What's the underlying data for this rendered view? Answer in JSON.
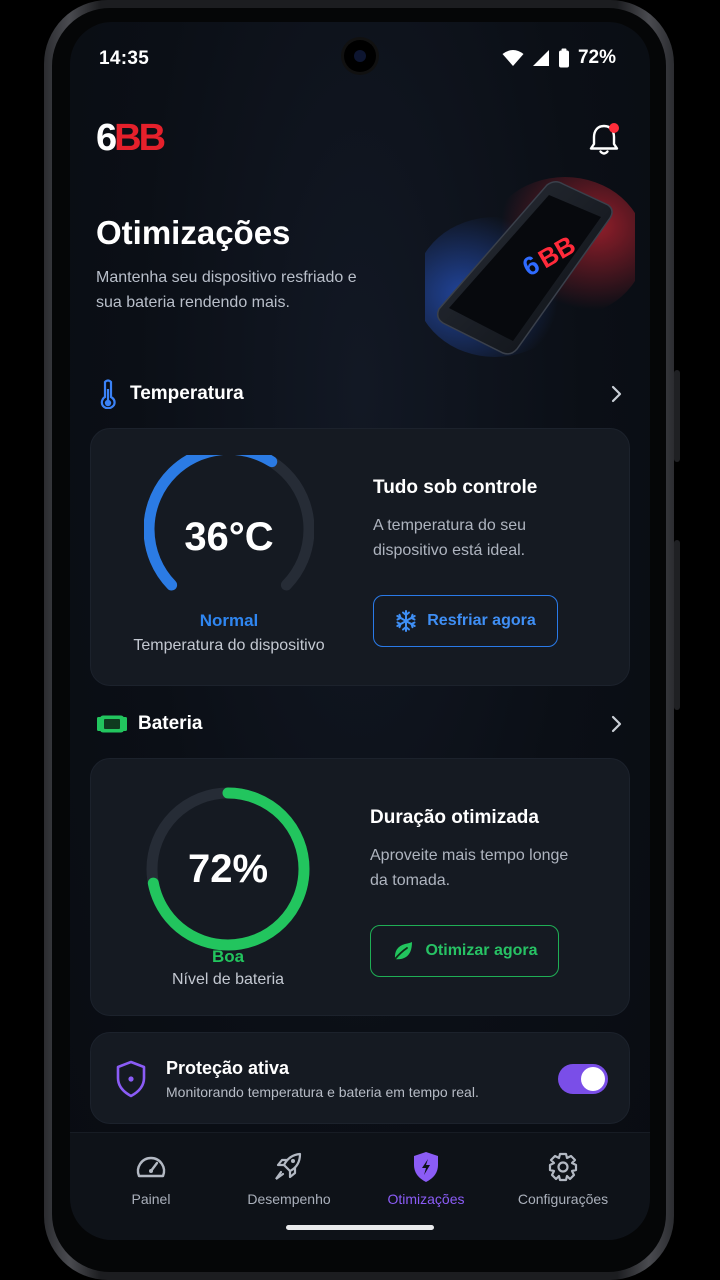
{
  "status_bar": {
    "time": "14:35",
    "battery": "72%"
  },
  "header": {
    "logo_six": "6",
    "logo_bb": "BB"
  },
  "page": {
    "title": "Otimizações",
    "subtitle": "Mantenha seu dispositivo resfriado e sua bateria rendendo mais."
  },
  "temperature": {
    "section_label": "Temperatura",
    "value": "36°C",
    "status": "Normal",
    "caption": "Temperatura do dispositivo",
    "title": "Tudo sob controle",
    "description": "A temperatura do seu dispositivo está ideal.",
    "button": "Resfriar agora",
    "level": 0.62
  },
  "battery": {
    "section_label": "Bateria",
    "value": "72%",
    "status": "Boa",
    "caption": "Nível de bateria",
    "title": "Duração otimizada",
    "description": "Aproveite mais tempo longe da tomada.",
    "button": "Otimizar agora",
    "level": 0.72
  },
  "protection": {
    "title": "Proteção ativa",
    "description": "Monitorando temperatura e bateria em tempo real.",
    "enabled": true
  },
  "nav": {
    "items": [
      {
        "label": "Painel",
        "icon": "speedometer-icon"
      },
      {
        "label": "Desempenho",
        "icon": "rocket-icon"
      },
      {
        "label": "Otimizações",
        "icon": "shield-bolt-icon",
        "active": true
      },
      {
        "label": "Configurações",
        "icon": "gear-icon"
      }
    ]
  },
  "colors": {
    "accent_blue": "#2a7ae8",
    "accent_green": "#22c55e",
    "accent_purple": "#8b5cf6",
    "brand_red": "#e5202b"
  }
}
